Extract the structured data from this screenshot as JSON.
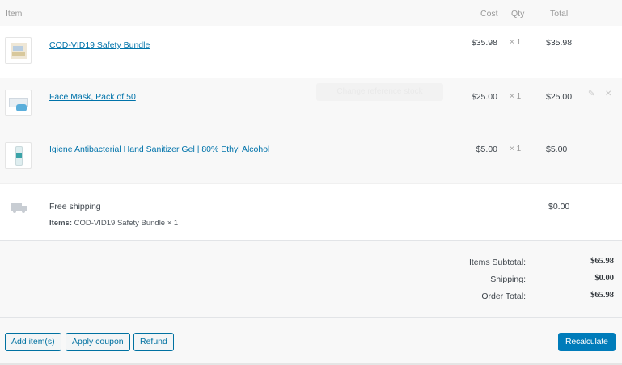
{
  "header": {
    "item": "Item",
    "cost": "Cost",
    "qty": "Qty",
    "total": "Total"
  },
  "items": [
    {
      "name": "COD-VID19 Safety Bundle",
      "cost": "$35.98",
      "qty": "× 1",
      "total": "$35.98"
    },
    {
      "name": "Face Mask, Pack of 50",
      "cost": "$25.00",
      "qty": "× 1",
      "total": "$25.00"
    },
    {
      "name": "Igiene Antibacterial Hand Sanitizer Gel | 80% Ethyl Alcohol",
      "cost": "$5.00",
      "qty": "× 1",
      "total": "$5.00"
    }
  ],
  "shipping": {
    "method": "Free shipping",
    "items_label": "Items:",
    "items_value": "COD-VID19 Safety Bundle × 1",
    "total": "$0.00"
  },
  "totals": {
    "subtotal_label": "Items Subtotal:",
    "subtotal_value": "$65.98",
    "shipping_label": "Shipping:",
    "shipping_value": "$0.00",
    "order_label": "Order Total:",
    "order_value": "$65.98"
  },
  "actions": {
    "add_items": "Add item(s)",
    "apply_coupon": "Apply coupon",
    "refund": "Refund",
    "recalculate": "Recalculate",
    "change_reference_stock": "Change reference stock"
  },
  "colors": {
    "link": "#0073aa",
    "primary": "#007cba",
    "row_alt": "#f8f8f8"
  },
  "icons": {
    "edit": "pencil-icon",
    "delete": "close-icon",
    "shipping": "truck-icon"
  }
}
